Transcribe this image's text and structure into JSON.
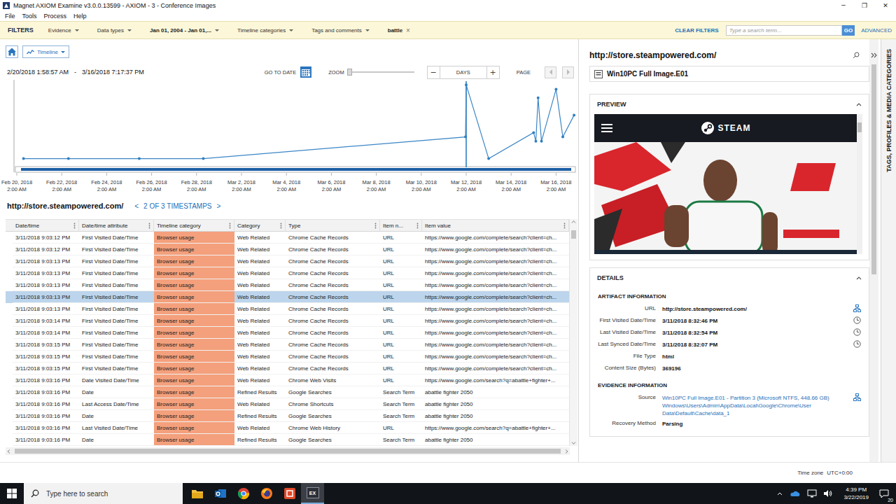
{
  "window": {
    "title": "Magnet AXIOM Examine v3.0.0.13599 - AXIOM - 3 - Conference Images",
    "controls": [
      "─",
      "❐",
      "✕"
    ]
  },
  "menu": [
    "File",
    "Tools",
    "Process",
    "Help"
  ],
  "filters": {
    "label": "FILTERS",
    "items": [
      {
        "label": "Evidence",
        "kind": "dropdown",
        "active": false
      },
      {
        "label": "Data types",
        "kind": "dropdown",
        "active": false
      },
      {
        "label": "Jan 01, 2004 - Jan 01,...",
        "kind": "dropdown",
        "active": true
      },
      {
        "label": "Timeline categories",
        "kind": "dropdown",
        "active": false
      },
      {
        "label": "Tags and comments",
        "kind": "dropdown",
        "active": false
      },
      {
        "label": "battle",
        "kind": "chip",
        "active": true,
        "remove": "×"
      }
    ],
    "clear": "CLEAR FILTERS",
    "search_placeholder": "Type a search term...",
    "go": "GO",
    "advanced": "ADVANCED"
  },
  "timeline": {
    "view": "Timeline",
    "range_start": "2/20/2018 1:58:57 AM",
    "range_sep": "-",
    "range_end": "3/16/2018 7:17:37 PM",
    "go_to_date": "GO TO DATE",
    "zoom": {
      "label": "ZOOM",
      "level": 0
    },
    "unit": {
      "minus": "−",
      "value": "DAYS",
      "plus": "+"
    },
    "page": {
      "label": "PAGE",
      "prev_disabled": true,
      "next_disabled": true
    },
    "chart": {
      "x_labels": [
        {
          "date": "Feb 20, 2018",
          "time": "2:00 AM"
        },
        {
          "date": "Feb 22, 2018",
          "time": "2:00 AM"
        },
        {
          "date": "Feb 24, 2018",
          "time": "2:00 AM"
        },
        {
          "date": "Feb 26, 2018",
          "time": "2:00 AM"
        },
        {
          "date": "Feb 28, 2018",
          "time": "2:00 AM"
        },
        {
          "date": "Mar 2, 2018",
          "time": "2:00 AM"
        },
        {
          "date": "Mar 4, 2018",
          "time": "2:00 AM"
        },
        {
          "date": "Mar 6, 2018",
          "time": "2:00 AM"
        },
        {
          "date": "Mar 8, 2018",
          "time": "2:00 AM"
        },
        {
          "date": "Mar 10, 2018",
          "time": "2:00 AM"
        },
        {
          "date": "Mar 12, 2018",
          "time": "2:00 AM"
        },
        {
          "date": "Mar 14, 2018",
          "time": "2:00 AM"
        },
        {
          "date": "Mar 16, 2018",
          "time": "2:00 AM"
        }
      ],
      "series": [
        {
          "days": [
            0.3,
            2.3,
            5.45,
            8.3,
            19.97,
            20.0,
            21.0,
            23.0,
            23.1,
            23.2,
            23.35,
            24.0,
            24.3,
            24.8
          ],
          "values": [
            1,
            1,
            1,
            1,
            3.5,
            9.5,
            1,
            4,
            3,
            8,
            3,
            9,
            3.5,
            6
          ],
          "selected_index": 5
        }
      ]
    }
  },
  "table": {
    "title": "http://store.steampowered.com/",
    "pager": {
      "prev": "<",
      "text": "2 OF 3 TIMESTAMPS",
      "next": ">"
    },
    "columns": [
      "Date/time",
      "Date/time attribute",
      "Timeline category",
      "Category",
      "Type",
      "Item n...",
      "Item value"
    ],
    "rows": [
      {
        "cells": [
          "3/11/2018 9:03:12 PM",
          "First Visited Date/Time",
          "Browser usage",
          "Web Related",
          "Chrome Cache Records",
          "URL",
          "https://www.google.com/complete/search?client=ch..."
        ],
        "selected": false,
        "color": "#f4a07c"
      },
      {
        "cells": [
          "3/11/2018 9:03:12 PM",
          "First Visited Date/Time",
          "Browser usage",
          "Web Related",
          "Chrome Cache Records",
          "URL",
          "https://www.google.com/complete/search?client=ch..."
        ],
        "selected": false,
        "color": "#f4a07c"
      },
      {
        "cells": [
          "3/11/2018 9:03:13 PM",
          "First Visited Date/Time",
          "Browser usage",
          "Web Related",
          "Chrome Cache Records",
          "URL",
          "https://www.google.com/complete/search?client=ch..."
        ],
        "selected": false,
        "color": "#f4a07c"
      },
      {
        "cells": [
          "3/11/2018 9:03:13 PM",
          "First Visited Date/Time",
          "Browser usage",
          "Web Related",
          "Chrome Cache Records",
          "URL",
          "https://www.google.com/complete/search?client=ch..."
        ],
        "selected": false,
        "color": "#f4a07c"
      },
      {
        "cells": [
          "3/11/2018 9:03:13 PM",
          "First Visited Date/Time",
          "Browser usage",
          "Web Related",
          "Chrome Cache Records",
          "URL",
          "https://www.google.com/complete/search?client=ch..."
        ],
        "selected": false,
        "color": "#f4a07c"
      },
      {
        "cells": [
          "3/11/2018 9:03:13 PM",
          "First Visited Date/Time",
          "Browser usage",
          "Web Related",
          "Chrome Cache Records",
          "URL",
          "https://www.google.com/complete/search?client=ch..."
        ],
        "selected": true,
        "color": "#f4a07c"
      },
      {
        "cells": [
          "3/11/2018 9:03:13 PM",
          "First Visited Date/Time",
          "Browser usage",
          "Web Related",
          "Chrome Cache Records",
          "URL",
          "https://www.google.com/complete/search?client=ch..."
        ],
        "selected": false,
        "color": "#f4a07c"
      },
      {
        "cells": [
          "3/11/2018 9:03:14 PM",
          "First Visited Date/Time",
          "Browser usage",
          "Web Related",
          "Chrome Cache Records",
          "URL",
          "https://www.google.com/complete/search?client=ch..."
        ],
        "selected": false,
        "color": "#f4a07c"
      },
      {
        "cells": [
          "3/11/2018 9:03:14 PM",
          "First Visited Date/Time",
          "Browser usage",
          "Web Related",
          "Chrome Cache Records",
          "URL",
          "https://www.google.com/complete/search?client=ch..."
        ],
        "selected": false,
        "color": "#f4a07c"
      },
      {
        "cells": [
          "3/11/2018 9:03:15 PM",
          "First Visited Date/Time",
          "Browser usage",
          "Web Related",
          "Chrome Cache Records",
          "URL",
          "https://www.google.com/complete/search?client=ch..."
        ],
        "selected": false,
        "color": "#f4a07c"
      },
      {
        "cells": [
          "3/11/2018 9:03:15 PM",
          "First Visited Date/Time",
          "Browser usage",
          "Web Related",
          "Chrome Cache Records",
          "URL",
          "https://www.google.com/complete/search?client=ch..."
        ],
        "selected": false,
        "color": "#f4a07c"
      },
      {
        "cells": [
          "3/11/2018 9:03:15 PM",
          "First Visited Date/Time",
          "Browser usage",
          "Web Related",
          "Chrome Cache Records",
          "URL",
          "https://www.google.com/complete/search?client=ch..."
        ],
        "selected": false,
        "color": "#f4a07c"
      },
      {
        "cells": [
          "3/11/2018 9:03:16 PM",
          "Date Visited Date/Time",
          "Browser usage",
          "Web Related",
          "Chrome Web Visits",
          "URL",
          "https://www.google.com/search?q=abattle+fighter+..."
        ],
        "selected": false,
        "color": "#f4a07c"
      },
      {
        "cells": [
          "3/11/2018 9:03:16 PM",
          "Date",
          "Browser usage",
          "Refined Results",
          "Google Searches",
          "Search Term",
          "abattle fighter 2050"
        ],
        "selected": false,
        "color": "#f4a07c"
      },
      {
        "cells": [
          "3/11/2018 9:03:16 PM",
          "Last Access Date/Time",
          "Browser usage",
          "Web Related",
          "Chrome Shortcuts",
          "Search Term",
          "abattle fighter 2050"
        ],
        "selected": false,
        "color": "#f4a07c"
      },
      {
        "cells": [
          "3/11/2018 9:03:16 PM",
          "Date",
          "Browser usage",
          "Refined Results",
          "Google Searches",
          "Search Term",
          "abattle fighter 2050"
        ],
        "selected": false,
        "color": "#f4a07c"
      },
      {
        "cells": [
          "3/11/2018 9:03:16 PM",
          "Last Visited Date/Time",
          "Browser usage",
          "Web Related",
          "Chrome Web History",
          "URL",
          "https://www.google.com/search?q=abattle+fighter+..."
        ],
        "selected": false,
        "color": "#f4a07c"
      },
      {
        "cells": [
          "3/11/2018 9:03:16 PM",
          "Date",
          "Browser usage",
          "Refined Results",
          "Google Searches",
          "Search Term",
          "abattle fighter 2050"
        ],
        "selected": false,
        "color": "#f4a07c"
      }
    ]
  },
  "details": {
    "title": "http://store.steampowered.com/",
    "evidence": "Win10PC Full Image.E01",
    "preview": {
      "title": "PREVIEW",
      "site": "STEAM"
    },
    "details_title": "DETAILS",
    "sections": [
      {
        "title": "ARTIFACT INFORMATION",
        "fields": [
          {
            "label": "URL",
            "lines": [
              "http://store.steampowered.com/"
            ],
            "kind": "link",
            "link": false
          },
          {
            "label": "First Visited Date/Time",
            "lines": [
              "3/11/2018 8:32:46 PM"
            ],
            "kind": "time",
            "link": false
          },
          {
            "label": "Last Visited Date/Time",
            "lines": [
              "3/11/2018 8:32:54 PM"
            ],
            "kind": "time",
            "link": false
          },
          {
            "label": "Last Synced Date/Time",
            "lines": [
              "3/11/2018 8:32:07 PM"
            ],
            "kind": "time",
            "link": false
          },
          {
            "label": "File Type",
            "lines": [
              "html"
            ],
            "kind": "plain",
            "link": false
          },
          {
            "label": "Content Size (Bytes)",
            "lines": [
              "369196"
            ],
            "kind": "plain",
            "link": false
          }
        ]
      },
      {
        "title": "EVIDENCE INFORMATION",
        "fields": [
          {
            "label": "Source",
            "lines": [
              "Win10PC Full Image.E01 - Partition 3 (Microsoft NTFS, 448.66 GB)",
              "Windows\\Users\\Admin\\AppData\\Local\\Google\\Chrome\\User Data\\Default\\Cache\\data_1"
            ],
            "kind": "link",
            "link": true
          },
          {
            "label": "Recovery Method",
            "lines": [
              "Parsing"
            ],
            "kind": "plain",
            "link": false
          }
        ]
      }
    ]
  },
  "status": {
    "label": "Time zone",
    "value": "UTC+0:00"
  },
  "side_tab": "TAGS, PROFILES & MEDIA CATEGORIES",
  "taskbar": {
    "search_placeholder": "Type here to search",
    "apps": [
      {
        "kind": "explorer",
        "active": false
      },
      {
        "kind": "outlook",
        "active": false
      },
      {
        "kind": "chrome",
        "active": false
      },
      {
        "kind": "firefox",
        "active": false
      },
      {
        "kind": "red",
        "active": false
      },
      {
        "kind": "axiom",
        "active": true,
        "label": "EX"
      }
    ],
    "time": "4:39 PM",
    "date": "3/22/2019",
    "notifications": "20"
  }
}
